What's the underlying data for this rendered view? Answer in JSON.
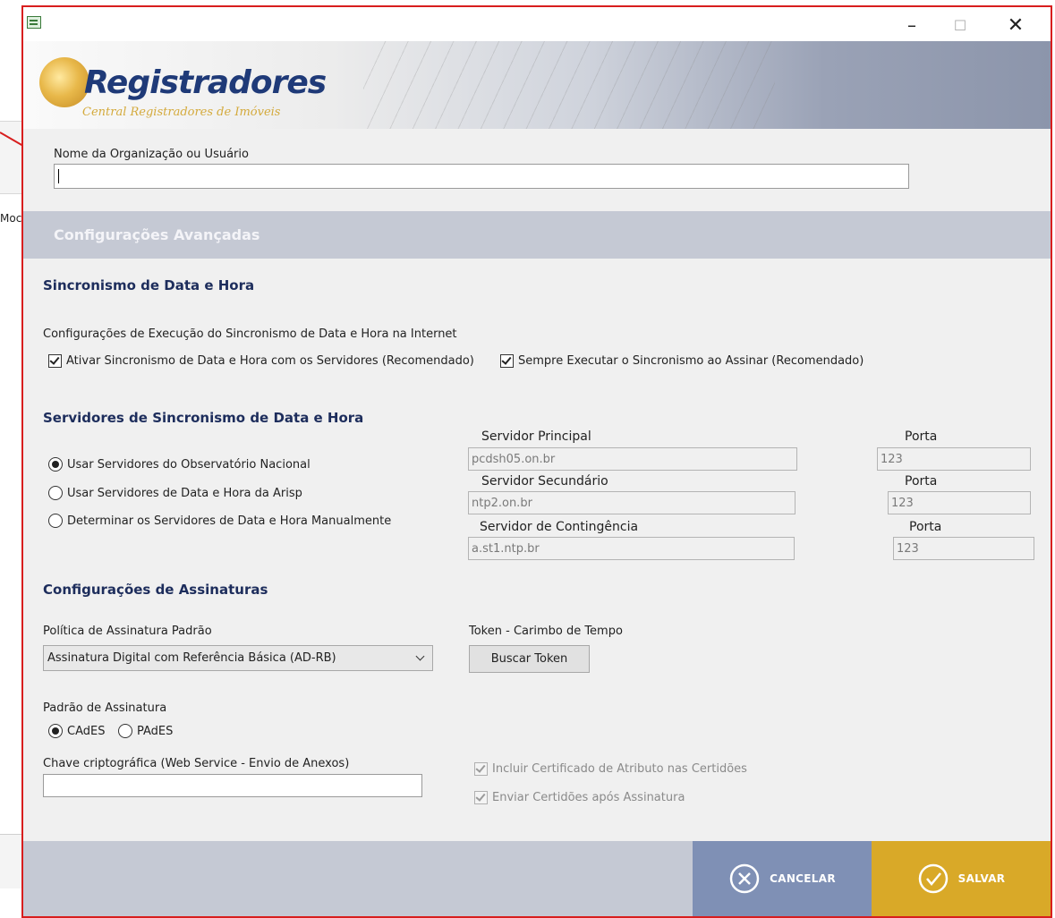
{
  "background": {
    "fragment_text": "Moc"
  },
  "window": {
    "buttons": {
      "minimize": "–",
      "maximize": "☐",
      "close": "✕"
    }
  },
  "logo": {
    "title": "Registradores",
    "subtitle": "Central Registradores de Imóveis"
  },
  "organization": {
    "label": "Nome da Organização ou Usuário",
    "value": ""
  },
  "advanced": {
    "title": "Configurações Avançadas"
  },
  "sync": {
    "title": "Sincronismo de Data e Hora",
    "description": "Configurações de Execução do Sincronismo de Data e Hora na Internet",
    "enable_checkbox": "Ativar Sincronismo de Data e Hora com os Servidores (Recomendado)",
    "always_checkbox": "Sempre Executar o Sincronismo ao Assinar (Recomendado)"
  },
  "servers": {
    "title": "Servidores de Sincronismo de Data e Hora",
    "options": [
      "Usar Servidores do Observatório Nacional",
      "Usar Servidores de Data e Hora da Arisp",
      "Determinar os Servidores de Data e Hora Manualmente"
    ],
    "selected_index": 0,
    "primary": {
      "label": "Servidor Principal",
      "value": "pcdsh05.on.br",
      "port_label": "Porta",
      "port": "123"
    },
    "secondary": {
      "label": "Servidor Secundário",
      "value": "ntp2.on.br",
      "port_label": "Porta",
      "port": "123"
    },
    "contingency": {
      "label": "Servidor de Contingência",
      "value": "a.st1.ntp.br",
      "port_label": "Porta",
      "port": "123"
    }
  },
  "signatures": {
    "title": "Configurações de Assinaturas",
    "policy_label": "Política de Assinatura Padrão",
    "policy_value": "Assinatura Digital com Referência Básica (AD-RB)",
    "token_label": "Token - Carimbo de Tempo",
    "token_button": "Buscar Token",
    "standard_label": "Padrão de Assinatura",
    "standard_options": [
      "CAdES",
      "PAdES"
    ],
    "standard_selected": 0,
    "key_label": "Chave criptográfica (Web Service - Envio de Anexos)",
    "key_value": "",
    "include_cert": "Incluir Certificado de Atributo nas Certidões",
    "send_after": "Enviar Certidões após Assinatura"
  },
  "footer": {
    "cancel": "CANCELAR",
    "save": "SALVAR"
  },
  "colors": {
    "frame": "#d81e1e",
    "header_band": "#c5c9d4",
    "cancel": "#7f90b5",
    "save": "#d9a928",
    "section_title": "#1d2d5c"
  }
}
